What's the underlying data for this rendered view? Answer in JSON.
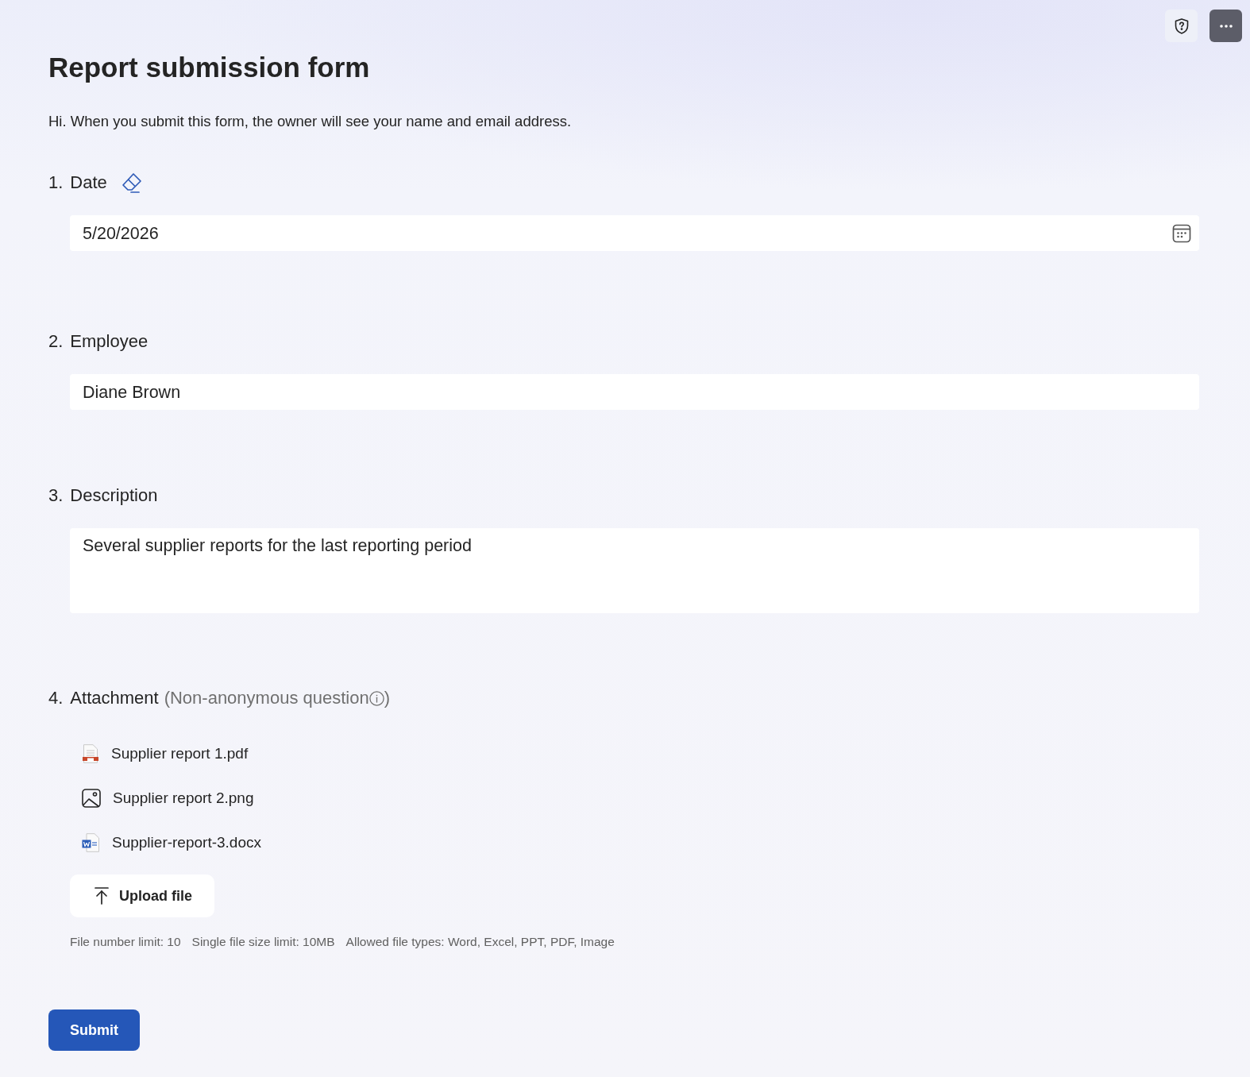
{
  "form": {
    "title": "Report submission form",
    "intro": "Hi. When you submit this form, the owner will see your name and email address."
  },
  "questions": [
    {
      "number": "1.",
      "label": "Date",
      "kind": "date",
      "clearable": true,
      "value": "5/20/2026"
    },
    {
      "number": "2.",
      "label": "Employee",
      "kind": "text",
      "clearable": false,
      "value": "Diane Brown"
    },
    {
      "number": "3.",
      "label": "Description",
      "kind": "textarea",
      "clearable": false,
      "value": "Several supplier reports for the last reporting period"
    },
    {
      "number": "4.",
      "label": "Attachment",
      "kind": "upload",
      "clearable": false,
      "note": "(Non-anonymous question",
      "note_close": ")",
      "files": [
        {
          "name": "Supplier report 1.pdf",
          "kind": "pdf"
        },
        {
          "name": "Supplier report 2.png",
          "kind": "image"
        },
        {
          "name": "Supplier-report-3.docx",
          "kind": "word"
        }
      ],
      "upload_button": "Upload file",
      "limits": [
        "File number limit: 10",
        "Single file size limit: 10MB",
        "Allowed file types: Word, Excel, PPT, PDF, Image"
      ]
    }
  ],
  "submit": "Submit"
}
